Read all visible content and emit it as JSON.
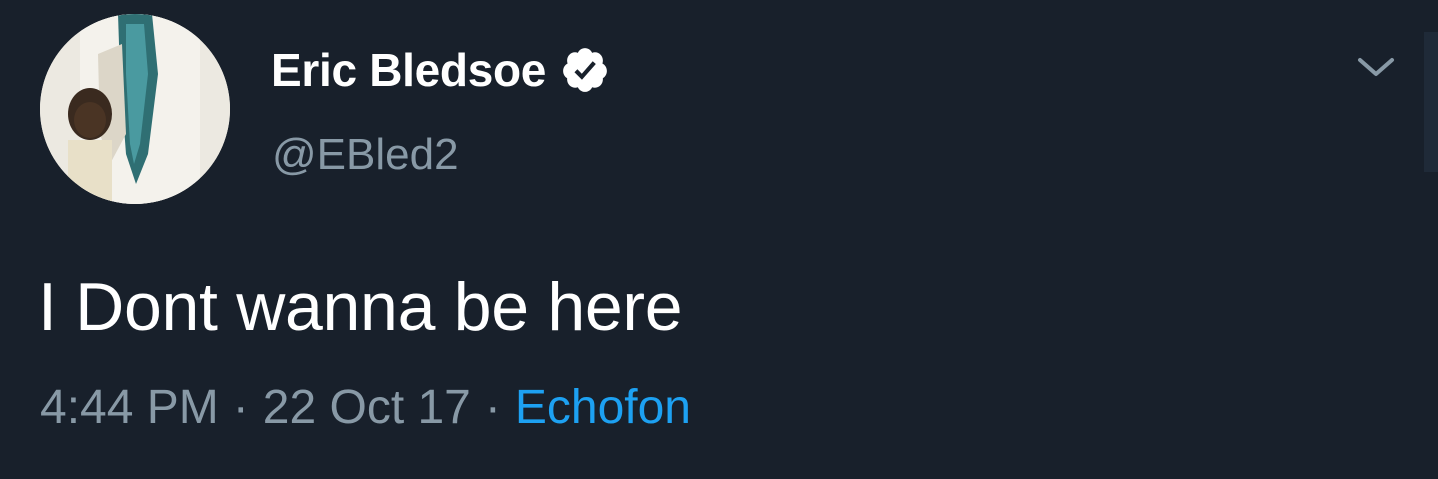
{
  "tweet": {
    "author": {
      "display_name": "Eric Bledsoe",
      "handle": "@EBled2",
      "verified": true
    },
    "text": "I Dont wanna be here",
    "time": "4:44 PM",
    "date": "22 Oct 17",
    "separator": "·",
    "source": "Echofon"
  },
  "icons": {
    "verified": "verified-badge-icon",
    "menu": "chevron-down-icon"
  },
  "colors": {
    "background": "#18202b",
    "primary_text": "#ffffff",
    "secondary_text": "#8899a6",
    "link": "#1da1f2"
  }
}
